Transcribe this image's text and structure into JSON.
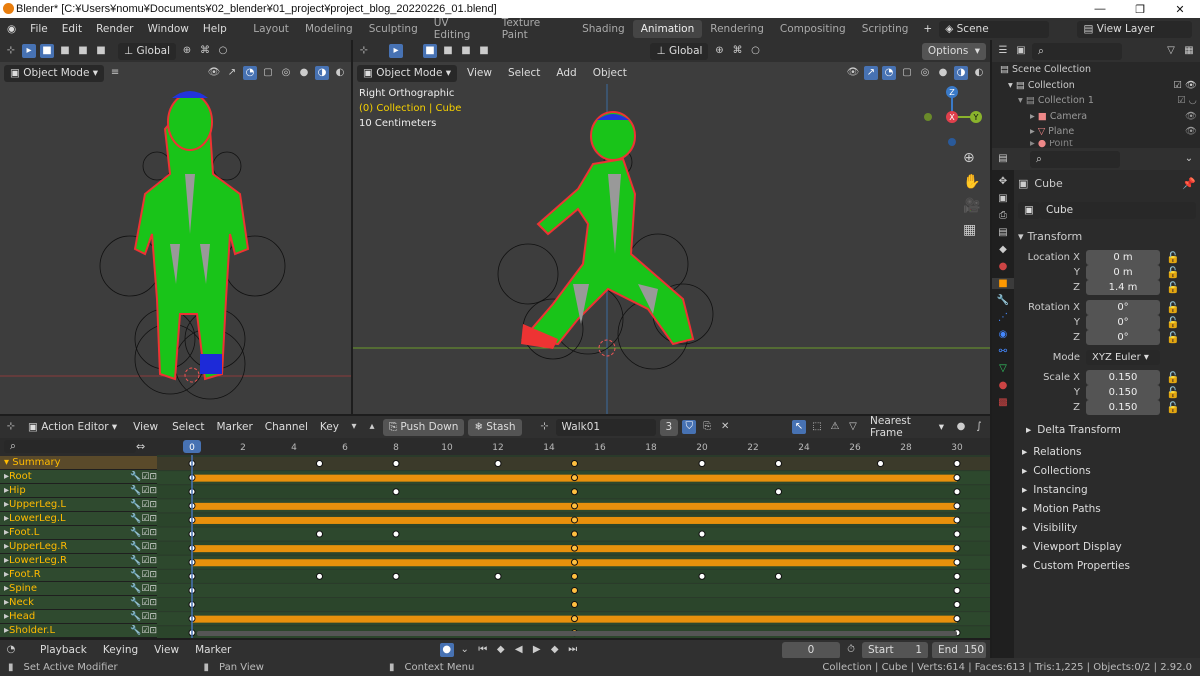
{
  "window": {
    "title": "Blender* [C:¥Users¥nomu¥Documents¥02_blender¥01_project¥project_blog_20220226_01.blend]",
    "controls": [
      "—",
      "❐",
      "✕"
    ]
  },
  "menu": {
    "items": [
      "File",
      "Edit",
      "Render",
      "Window",
      "Help"
    ],
    "workspaces": [
      "Layout",
      "Modeling",
      "Sculpting",
      "UV Editing",
      "Texture Paint",
      "Shading",
      "Animation",
      "Rendering",
      "Compositing",
      "Scripting"
    ],
    "active_workspace": "Animation",
    "add_tab": "+",
    "scene": "Scene",
    "view_layer": "View Layer"
  },
  "viewport_left": {
    "orientation": "Global",
    "mode": "Object Mode"
  },
  "viewport_main": {
    "orientation": "Global",
    "options": "Options",
    "mode": "Object Mode",
    "menus": [
      "View",
      "Select",
      "Add",
      "Object"
    ],
    "overlay_line1": "Right Orthographic",
    "overlay_line2": "(0) Collection | Cube",
    "overlay_line3": "10 Centimeters",
    "gizmo": {
      "z": "Z",
      "x": "X",
      "y": "Y"
    }
  },
  "outliner": {
    "scene_collection": "Scene Collection",
    "items": [
      {
        "label": "Collection",
        "indent": 1
      },
      {
        "label": "Collection 1",
        "indent": 2
      },
      {
        "label": "Camera",
        "indent": 3
      },
      {
        "label": "Plane",
        "indent": 3
      },
      {
        "label": "Point",
        "indent": 3
      }
    ]
  },
  "properties": {
    "object_name": "Cube",
    "object_field": "Cube",
    "transform_title": "Transform",
    "location": {
      "label": "Location X",
      "x": "0 m",
      "y": "0 m",
      "z": "1.4 m"
    },
    "rotation": {
      "label": "Rotation X",
      "x": "0°",
      "y": "0°",
      "z": "0°"
    },
    "mode_label": "Mode",
    "mode_value": "XYZ Euler",
    "scale": {
      "label": "Scale X",
      "x": "0.150",
      "y": "0.150",
      "z": "0.150"
    },
    "axis_y": "Y",
    "axis_z": "Z",
    "delta": "Delta Transform",
    "panels": [
      "Relations",
      "Collections",
      "Instancing",
      "Motion Paths",
      "Visibility",
      "Viewport Display",
      "Custom Properties"
    ]
  },
  "action_editor": {
    "editor": "Action Editor",
    "menus": [
      "View",
      "Select",
      "Marker",
      "Channel",
      "Key"
    ],
    "push_down": "Push Down",
    "stash": "Stash",
    "action": "Walk01",
    "users": "3",
    "snap": "Nearest Frame",
    "frame_ticks": [
      "0",
      "2",
      "4",
      "6",
      "8",
      "10",
      "12",
      "14",
      "16",
      "18",
      "20",
      "22",
      "24",
      "26",
      "28",
      "30"
    ],
    "summary": "Summary",
    "channels": [
      "Root",
      "Hip",
      "UpperLeg.L",
      "LowerLeg.L",
      "Foot.L",
      "UpperLeg.R",
      "LowerLeg.R",
      "Foot.R",
      "Spine",
      "Neck",
      "Head",
      "Sholder.L"
    ],
    "keyframes": {
      "Summary": [
        0,
        5,
        8,
        12,
        15,
        20,
        23,
        27,
        30
      ],
      "Root": [
        0,
        15,
        30
      ],
      "Hip": [
        0,
        8,
        15,
        23,
        30
      ],
      "UpperLeg.L": [
        0,
        15,
        30
      ],
      "LowerLeg.L": [
        0,
        15,
        30
      ],
      "Foot.L": [
        0,
        5,
        8,
        15,
        20,
        30
      ],
      "UpperLeg.R": [
        0,
        15,
        30
      ],
      "LowerLeg.R": [
        0,
        15,
        30
      ],
      "Foot.R": [
        0,
        5,
        8,
        12,
        15,
        20,
        23,
        30
      ],
      "Spine": [
        0,
        15,
        30
      ],
      "Neck": [
        0,
        15,
        30
      ],
      "Head": [
        0,
        15,
        30
      ],
      "Sholder.L": [
        0,
        15,
        30
      ]
    },
    "holds": [
      "Root",
      "UpperLeg.L",
      "LowerLeg.L",
      "UpperLeg.R",
      "LowerLeg.R",
      "Head"
    ]
  },
  "timeline": {
    "menus": [
      "Playback",
      "Keying",
      "View",
      "Marker"
    ],
    "current_frame": "0",
    "start_label": "Start",
    "start": "1",
    "end_label": "End",
    "end": "150"
  },
  "status": {
    "left": "Set Active Modifier",
    "middle": "Pan View",
    "right": "Context Menu",
    "stats": "Collection | Cube | Verts:614 | Faces:613 | Tris:1,225 | Objects:0/2 | 2.92.0"
  },
  "colors": {
    "accent": "#4772b3",
    "keyframe_hold": "#e8900c",
    "channel_text": "#ffb300",
    "active_tab": "#454545"
  }
}
